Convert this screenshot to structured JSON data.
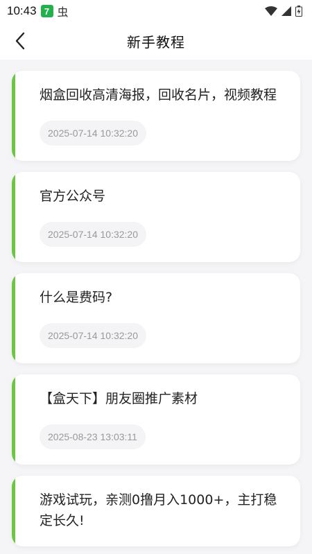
{
  "status_bar": {
    "time": "10:43",
    "app_badge": "7",
    "app_icon_2": "虫"
  },
  "header": {
    "back_icon": "chevron-left-icon",
    "title": "新手教程"
  },
  "colors": {
    "accent": "#6cc644",
    "background": "#f5f5f7"
  },
  "tutorials": [
    {
      "title": "烟盒回收高清海报，回收名片，视频教程",
      "date": "2025-07-14 10:32:20"
    },
    {
      "title": "官方公众号",
      "date": "2025-07-14 10:32:20"
    },
    {
      "title": "什么是费码?",
      "date": "2025-07-14 10:32:20"
    },
    {
      "title": "【盒天下】朋友圈推广素材",
      "date": "2025-08-23 13:03:11"
    },
    {
      "title": "游戏试玩，亲测0撸月入1000+，主打稳定长久!",
      "date": ""
    }
  ]
}
